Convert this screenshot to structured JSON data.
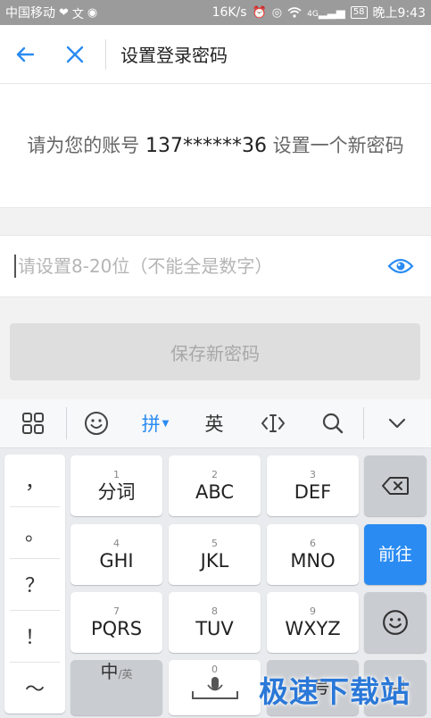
{
  "status_bar": {
    "carrier": "中国移动",
    "speed": "16K/s",
    "battery": "58",
    "time": "晚上9:43",
    "signal": "4G"
  },
  "header": {
    "back_icon": "arrow-left-icon",
    "close_icon": "close-icon",
    "title": "设置登录密码"
  },
  "message": {
    "prefix": "请为您的账号 ",
    "phone": "137******36",
    "suffix": " 设置一个新密码"
  },
  "password": {
    "placeholder": "请设置8-20位（不能全是数字）",
    "value": "",
    "visibility_icon": "eye-icon"
  },
  "save_button": {
    "label": "保存新密码",
    "enabled": false
  },
  "keyboard": {
    "toolbar": {
      "items": [
        "grid-icon",
        "emoji-icon",
        "拼",
        "英",
        "cursor-icon",
        "search-icon",
        "collapse-icon"
      ]
    },
    "punctuation": [
      "，",
      "。",
      "？",
      "！",
      "～"
    ],
    "keys": [
      {
        "num": "1",
        "label": "分词"
      },
      {
        "num": "2",
        "label": "ABC"
      },
      {
        "num": "3",
        "label": "DEF"
      },
      {
        "num": "4",
        "label": "GHI"
      },
      {
        "num": "5",
        "label": "JKL"
      },
      {
        "num": "6",
        "label": "MNO"
      },
      {
        "num": "7",
        "label": "PQRS"
      },
      {
        "num": "8",
        "label": "TUV"
      },
      {
        "num": "9",
        "label": "WXYZ"
      }
    ],
    "delete_icon": "backspace-icon",
    "go_label": "前往",
    "emoji_icon": "emoji-icon",
    "lang_main": "中",
    "lang_sub": "/英",
    "space_num": "0",
    "mic_icon": "mic-icon",
    "symbol_label": "符号"
  },
  "watermark": "极速下载站",
  "colors": {
    "accent": "#2a8bf2",
    "statusbar": "#9b9b9b",
    "button_disabled": "#dedede"
  }
}
